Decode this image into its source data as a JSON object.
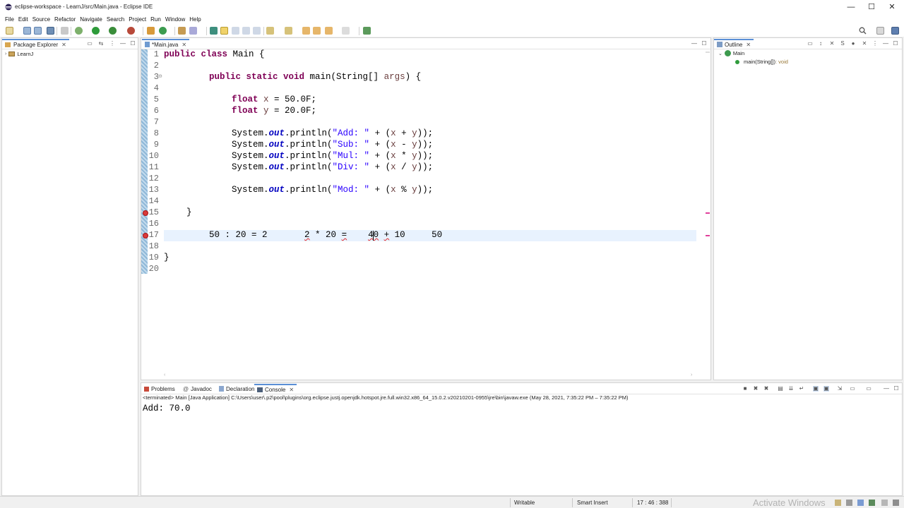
{
  "window": {
    "title": "eclipse-workspace - LearnJ/src/Main.java - Eclipse IDE",
    "minimize": "—",
    "maximize": "☐",
    "close": "✕"
  },
  "menu": [
    "File",
    "Edit",
    "Source",
    "Refactor",
    "Navigate",
    "Search",
    "Project",
    "Run",
    "Window",
    "Help"
  ],
  "package_explorer": {
    "tab_label": "Package Explorer",
    "project": "LearnJ"
  },
  "editor": {
    "tab_label": "*Main.java",
    "line_numbers": [
      "1",
      "2",
      "3",
      "4",
      "5",
      "6",
      "7",
      "8",
      "9",
      "10",
      "11",
      "12",
      "13",
      "14",
      "15",
      "16",
      "17",
      "18",
      "19",
      "20"
    ]
  },
  "outline": {
    "tab_label": "Outline",
    "class_name": "Main",
    "method_name": "main(String[])",
    "method_return": " : void"
  },
  "bottom_tabs": {
    "problems": "Problems",
    "javadoc": "Javadoc",
    "declaration": "Declaration",
    "console": "Console"
  },
  "console": {
    "header": "<terminated> Main [Java Application] C:\\Users\\user\\.p2\\pool\\plugins\\org.eclipse.justj.openjdk.hotspot.jre.full.win32.x86_64_15.0.2.v20210201-0955\\jre\\bin\\javaw.exe  (May 28, 2021, 7:35:22 PM – 7:35:22 PM)",
    "output": "Add: 70.0"
  },
  "status": {
    "writable": "Writable",
    "insert_mode": "Smart Insert",
    "position": "17 : 46 : 388"
  },
  "watermark": "Activate Windows"
}
